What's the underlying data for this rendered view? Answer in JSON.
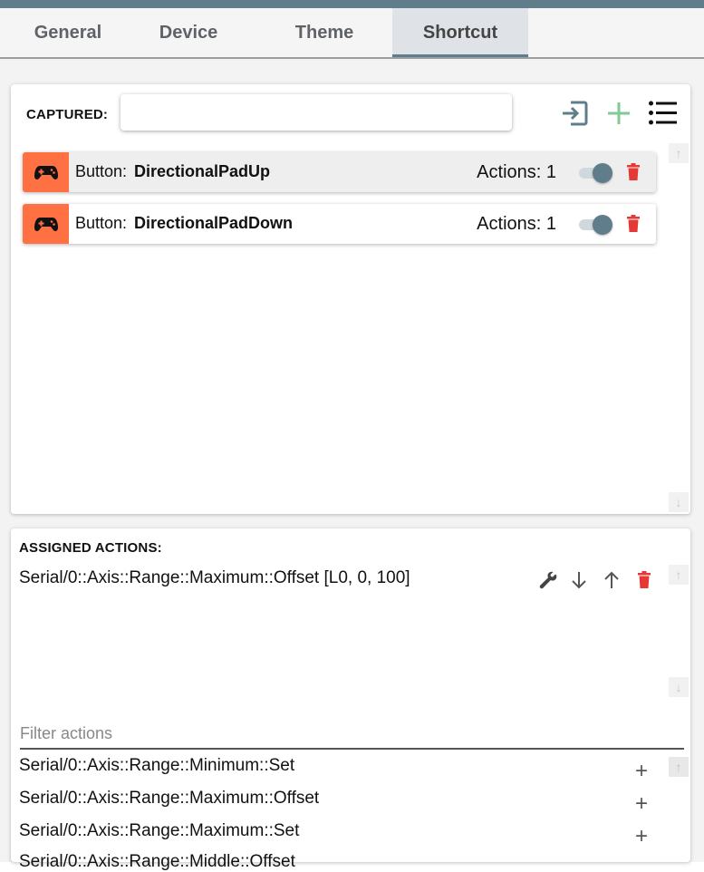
{
  "tabs": [
    {
      "label": "General",
      "active": false
    },
    {
      "label": "Device",
      "active": false
    },
    {
      "label": "Theme",
      "active": false
    },
    {
      "label": "Shortcut",
      "active": true
    }
  ],
  "captured": {
    "label": "CAPTURED:",
    "value": "",
    "icons": [
      "enter-icon",
      "plus-icon",
      "list-icon"
    ]
  },
  "bindings": [
    {
      "prefix": "Button:",
      "value": "DirectionalPadUp",
      "actions": "Actions: 1",
      "enabled": true,
      "selected": true
    },
    {
      "prefix": "Button:",
      "value": "DirectionalPadDown",
      "actions": "Actions: 1",
      "enabled": true,
      "selected": false
    }
  ],
  "assigned": {
    "label": "ASSIGNED ACTIONS:",
    "items": [
      "Serial/0::Axis::Range::Maximum::Offset [L0, 0, 100]"
    ]
  },
  "filter": {
    "placeholder": "Filter actions",
    "value": ""
  },
  "available_actions": [
    "Serial/0::Axis::Range::Minimum::Set",
    "Serial/0::Axis::Range::Maximum::Offset",
    "Serial/0::Axis::Range::Maximum::Set",
    "Serial/0::Axis::Range::Middle::Offset"
  ],
  "colors": {
    "accent": "#607d8b",
    "badge": "#ff7043",
    "add_green": "#81c995",
    "delete_red": "#e53935"
  }
}
